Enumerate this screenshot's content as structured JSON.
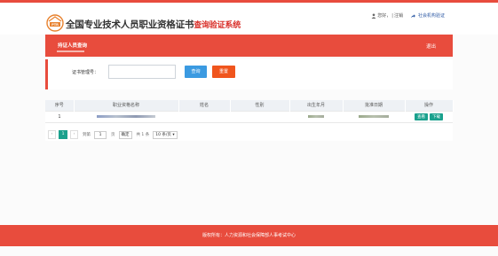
{
  "header": {
    "title": "全国专业技术人员职业资格证书",
    "subtitle": "查询验证系统",
    "logo_text": "PTR",
    "greeting": "您好，",
    "username": "",
    "logout": "注销",
    "org_link": "社会机构验证"
  },
  "nav": {
    "tab": "持证人员查询",
    "logout": "退出"
  },
  "search": {
    "label": "证书管理号：",
    "input_value": "",
    "query_button": "查询",
    "reset_button": "重置"
  },
  "table": {
    "columns": [
      "序号",
      "职业资格名称",
      "姓名",
      "性别",
      "出生年月",
      "批准日期",
      "操作"
    ],
    "rows": [
      {
        "index": "1",
        "view_button": "查看",
        "download_button": "下载"
      }
    ]
  },
  "pager": {
    "current_page": "1",
    "goto_label": "到第",
    "page_input": "1",
    "page_unit": "页",
    "confirm": "确定",
    "total": "共 1 条",
    "page_size": "10 条/页"
  },
  "footer": {
    "text": "版权所有：人力资源和社会保障部人事考试中心"
  },
  "colors": {
    "accent": "#e84c3d",
    "query": "#3b9ae1",
    "reset": "#f0551d",
    "action": "#1aa18d"
  }
}
